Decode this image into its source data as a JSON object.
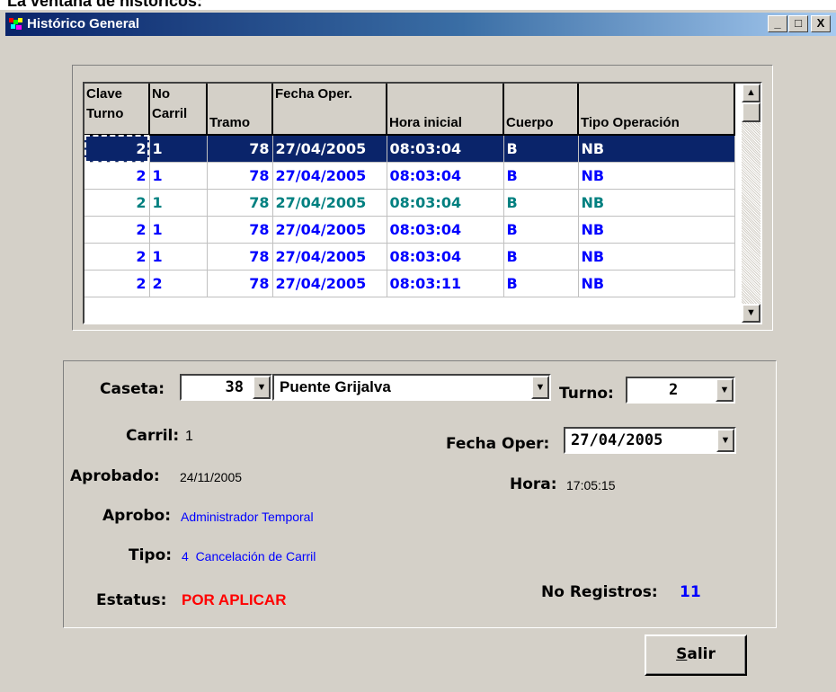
{
  "caption": "La ventana de históricos:",
  "window": {
    "title": "Histórico General",
    "min": "_",
    "max": "□",
    "close": "X"
  },
  "grid": {
    "headers": [
      "Clave Turno",
      "No Carril",
      "Tramo",
      "Fecha Oper.",
      "Hora inicial",
      "Cuerpo",
      "Tipo Operación"
    ],
    "rows": [
      {
        "clave": "2",
        "carril": "1",
        "tramo": "78",
        "fecha": "27/04/2005",
        "hora": "08:03:04",
        "cuerpo": "B",
        "tipo": "NB",
        "style": "sel"
      },
      {
        "clave": "2",
        "carril": "1",
        "tramo": "78",
        "fecha": "27/04/2005",
        "hora": "08:03:04",
        "cuerpo": "B",
        "tipo": "NB",
        "style": "blue"
      },
      {
        "clave": "2",
        "carril": "1",
        "tramo": "78",
        "fecha": "27/04/2005",
        "hora": "08:03:04",
        "cuerpo": "B",
        "tipo": "NB",
        "style": "teal"
      },
      {
        "clave": "2",
        "carril": "1",
        "tramo": "78",
        "fecha": "27/04/2005",
        "hora": "08:03:04",
        "cuerpo": "B",
        "tipo": "NB",
        "style": "blue"
      },
      {
        "clave": "2",
        "carril": "1",
        "tramo": "78",
        "fecha": "27/04/2005",
        "hora": "08:03:04",
        "cuerpo": "B",
        "tipo": "NB",
        "style": "blue"
      },
      {
        "clave": "2",
        "carril": "2",
        "tramo": "78",
        "fecha": "27/04/2005",
        "hora": "08:03:11",
        "cuerpo": "B",
        "tipo": "NB",
        "style": "blue"
      }
    ]
  },
  "form": {
    "caseta_label": "Caseta:",
    "caseta_num": "38",
    "caseta_name": "Puente Grijalva",
    "turno_label": "Turno:",
    "turno_value": "2",
    "carril_label": "Carril:",
    "carril_value": "1",
    "fecha_label": "Fecha Oper:",
    "fecha_value": "27/04/2005",
    "aprobado_label": "Aprobado:",
    "aprobado_value": "24/11/2005",
    "hora_label": "Hora:",
    "hora_value": "17:05:15",
    "aprobo_label": "Aprobo:",
    "aprobo_value": "Administrador Temporal",
    "tipo_label": "Tipo:",
    "tipo_value": "4  Cancelación de Carril",
    "estatus_label": "Estatus:",
    "estatus_value": "POR APLICAR",
    "registros_label": "No Registros:",
    "registros_value": "11"
  },
  "buttons": {
    "salir_mnemonic": "S",
    "salir_rest": "alir"
  },
  "colors": {
    "selected": "#0a246a",
    "blue_text": "#0000ff",
    "teal_text": "#008080",
    "status": "#ff0000"
  }
}
